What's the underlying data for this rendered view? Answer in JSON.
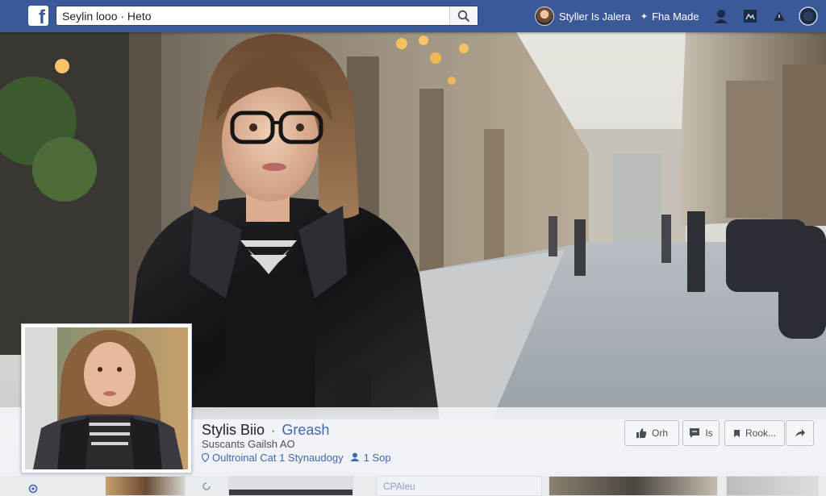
{
  "app": {
    "logo_letter": "f"
  },
  "search": {
    "value": "Seylin looo · Heto"
  },
  "nav": {
    "user_name": "Styller Is Jalera",
    "flag_glyph": "✦",
    "home_label": "Fha Made"
  },
  "profile": {
    "name": "Stylis Biio",
    "separator": "·",
    "subtitle": "Greash",
    "line2": "Suscants Gailsh AO",
    "line3_a": "Oultroinal Cat 1 Stynaudogy",
    "line3_b": "1 Sop"
  },
  "actions": {
    "like_label": "Orh",
    "message_label": "Is",
    "more_label": "Rook..."
  },
  "strip": {
    "card_label": "CPAleu"
  },
  "colors": {
    "brand": "#3b5998",
    "link": "#4267b2",
    "topbar_text": "#ffffff"
  }
}
